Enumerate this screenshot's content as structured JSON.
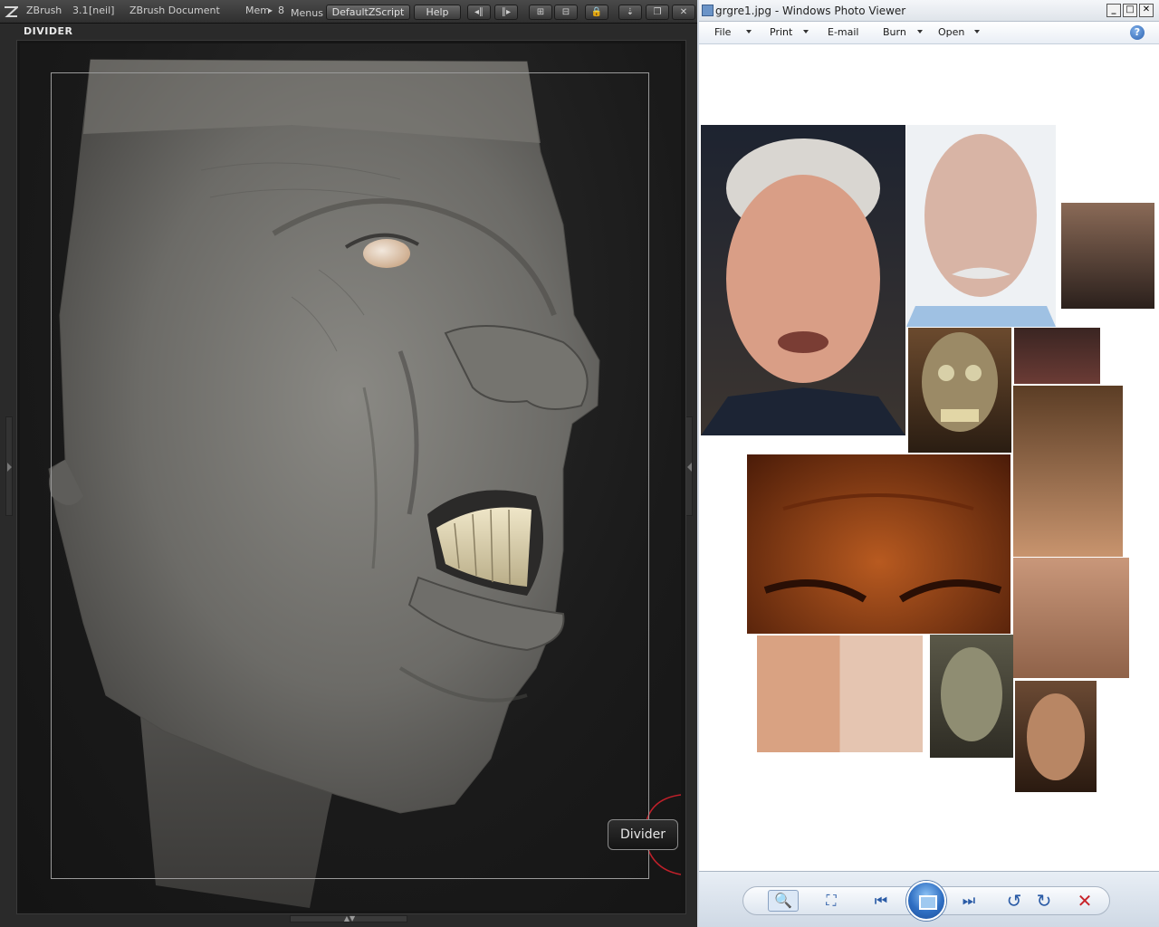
{
  "zbrush": {
    "app": "ZBrush",
    "version": "3.1",
    "user": "[neil]",
    "document": "ZBrush Document",
    "mem": "Mem",
    "mem_value": "8",
    "menus": "Menus",
    "script": "DefaultZScript",
    "help": "Help",
    "panel_title": "DIVIDER",
    "tooltip": "Divider"
  },
  "viewer": {
    "title": "grgre1.jpg - Windows Photo Viewer",
    "menu": {
      "file": "File",
      "print": "Print",
      "email": "E-mail",
      "burn": "Burn",
      "open": "Open"
    },
    "help": "?",
    "controls": {
      "prev": "⏮",
      "next": "⏭",
      "rotate_ccw": "↺",
      "rotate_cw": "↻",
      "delete": "✕",
      "actual_size": "⛶",
      "zoom": "🔍"
    }
  },
  "colors": {
    "zbrush_bg": "#2a2a2a",
    "sculpt_gray": "#6f6e6a",
    "viewer_accent": "#2c62b0",
    "delete_red": "#c8232a"
  }
}
